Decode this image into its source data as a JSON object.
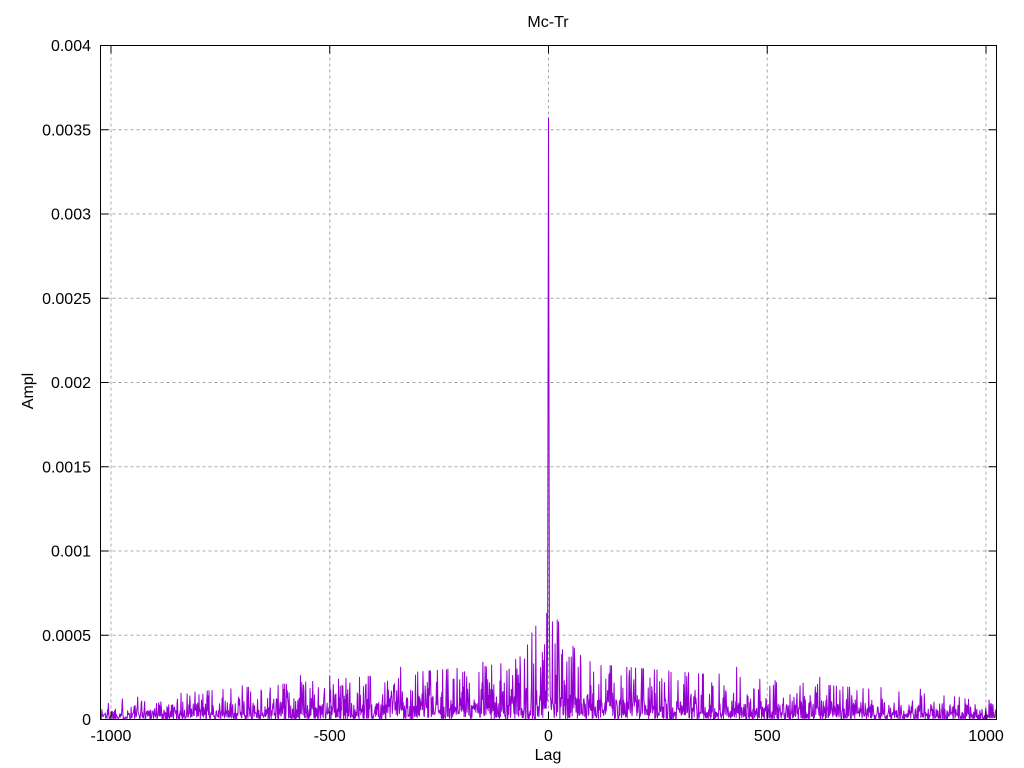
{
  "chart_data": {
    "type": "line",
    "title": "Mc-Tr",
    "xlabel": "Lag",
    "ylabel": "Ampl",
    "xlim": [
      -1024,
      1024
    ],
    "ylim": [
      0,
      0.004
    ],
    "xticks": [
      -1000,
      -500,
      0,
      500,
      1000
    ],
    "xtick_labels": [
      "-1000",
      "-500",
      "0",
      "500",
      "1000"
    ],
    "yticks": [
      0,
      0.0005,
      0.001,
      0.0015,
      0.002,
      0.0025,
      0.003,
      0.0035,
      0.004
    ],
    "ytick_labels": [
      "0",
      "0.0005",
      "0.001",
      "0.0015",
      "0.002",
      "0.0025",
      "0.003",
      "0.0035",
      "0.004"
    ],
    "grid": true,
    "grid_color": "#a8a8a8",
    "line_color": "#9400d3",
    "border_color": "#000000",
    "background_color": "#ffffff",
    "peak": {
      "lag": 0,
      "value": 0.003571
    },
    "key_points": [
      [
        -2,
        0.0005
      ],
      [
        -1,
        0.00215
      ],
      [
        0,
        0.003571
      ],
      [
        1,
        0.00215
      ],
      [
        2,
        0.0006
      ],
      [
        9,
        0.00058
      ],
      [
        -12,
        0.00035
      ],
      [
        22,
        0.0004
      ],
      [
        -34,
        0.00033
      ],
      [
        47,
        0.00037
      ],
      [
        -55,
        0.00036
      ],
      [
        68,
        0.00031
      ],
      [
        -90,
        0.0003
      ],
      [
        120,
        0.00032
      ],
      [
        -150,
        0.00034
      ],
      [
        185,
        0.00029
      ],
      [
        -230,
        0.0003
      ],
      [
        280,
        0.00028
      ],
      [
        -338,
        0.00031
      ],
      [
        390,
        0.00027
      ],
      [
        430,
        0.00031
      ],
      [
        -500,
        0.00026
      ],
      [
        -567,
        0.00026
      ],
      [
        620,
        0.00025
      ],
      [
        -700,
        0.0002
      ],
      [
        760,
        0.00019
      ],
      [
        -820,
        0.00014
      ],
      [
        850,
        0.00018
      ],
      [
        -930,
        0.00011
      ],
      [
        960,
        0.00012
      ]
    ],
    "noise": {
      "seed": 1337,
      "lag_min": -1023,
      "lag_max": 1023,
      "envelope_center": 0.00011,
      "edge_factor": 0.32,
      "center_bump_gain": 0.8,
      "center_bump_width": 55,
      "max_multiplier": 3.2,
      "description": "white-noise floor tapering from center (typical ~0.0001, spikes to ~0.0004) toward edges (typical ~0.00003, spikes to ~0.0001); sharp correlation peak 0.003571 at lag 0"
    }
  }
}
